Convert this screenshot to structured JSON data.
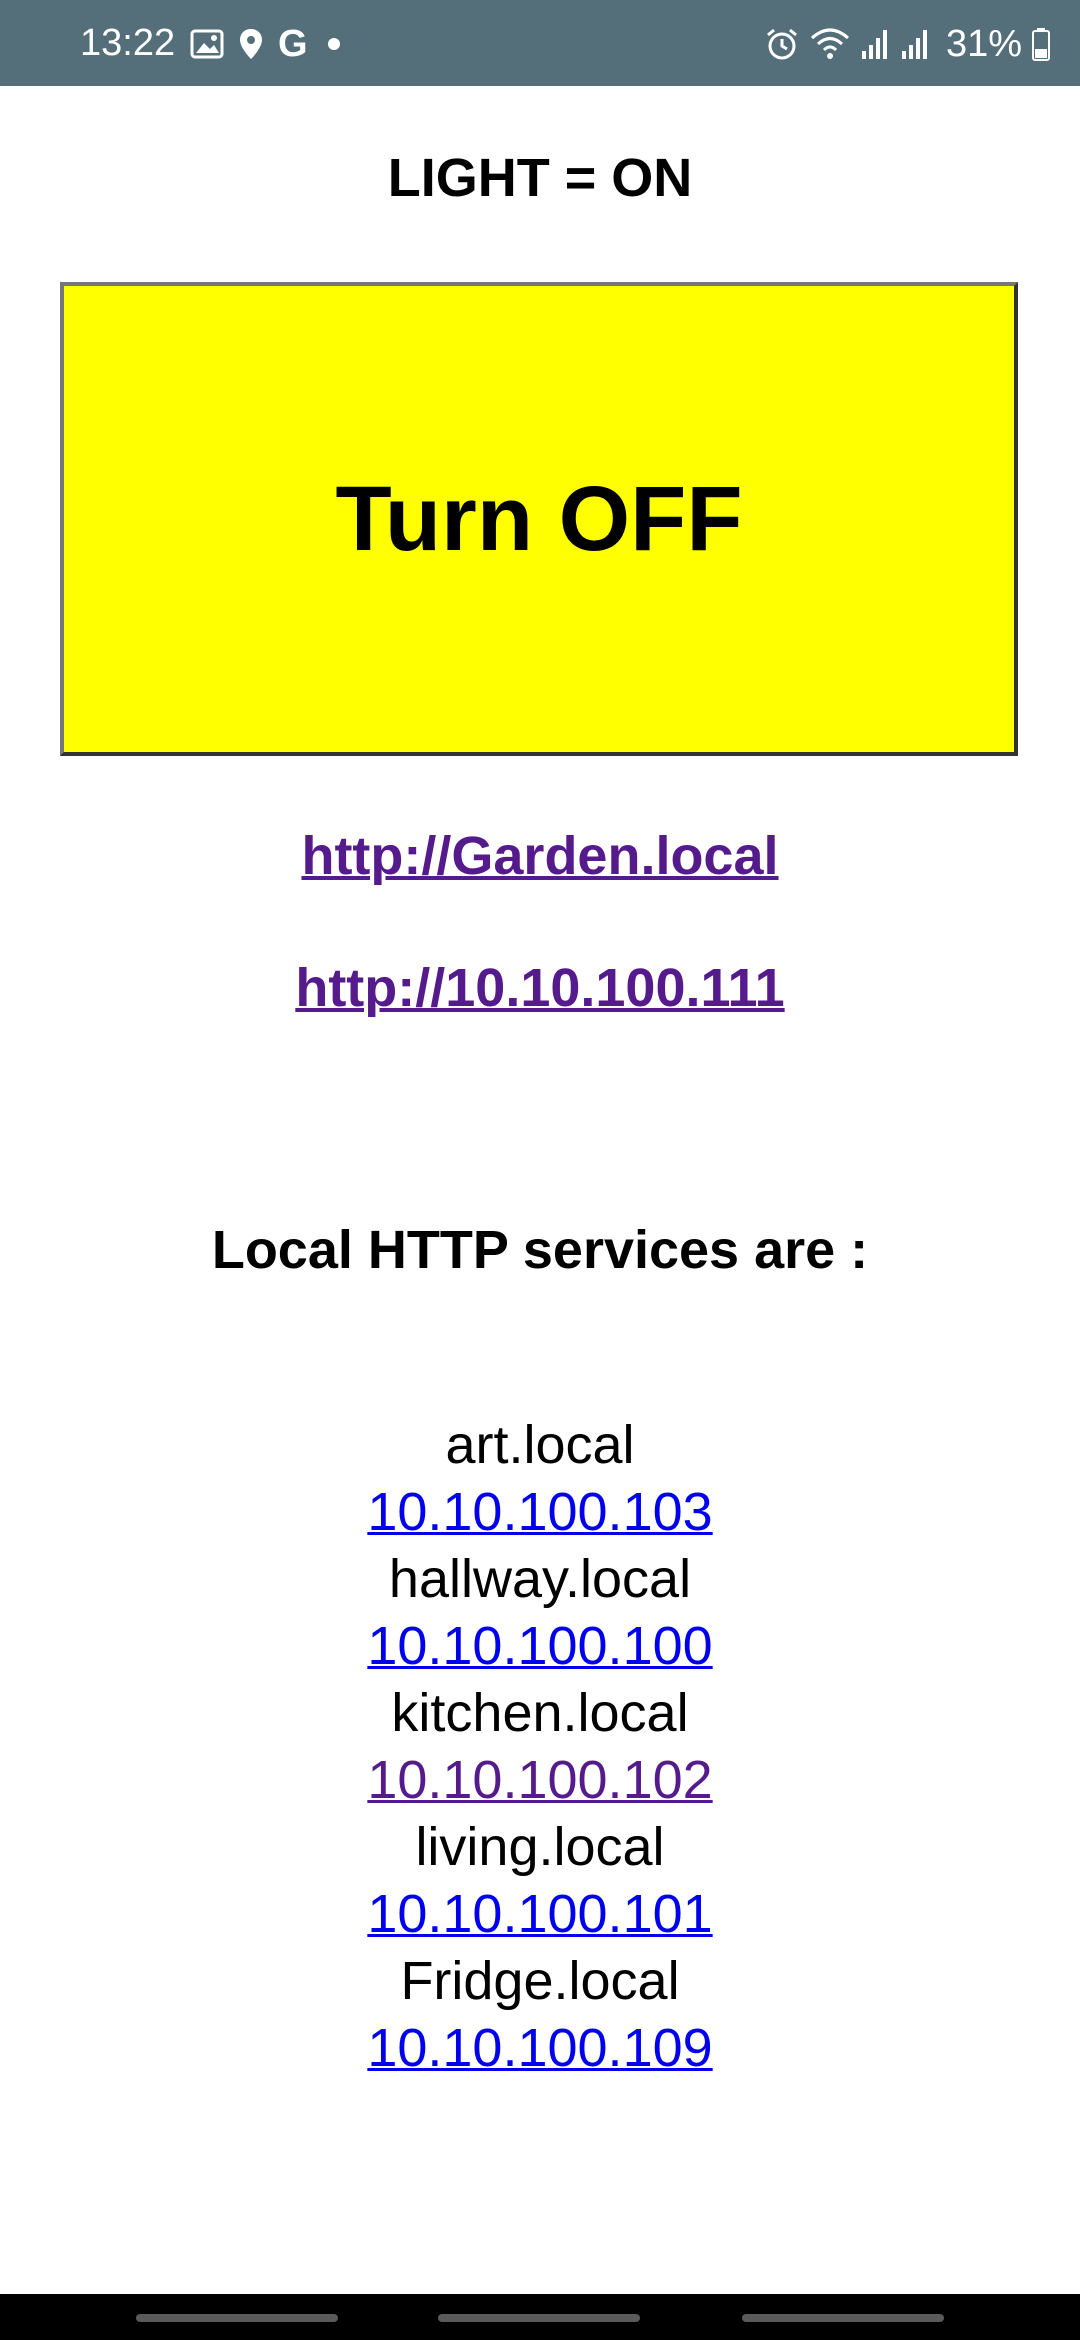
{
  "status_bar": {
    "time": "13:22",
    "battery": "31%",
    "left_icons": [
      "image-icon",
      "location-icon",
      "google-icon",
      "dot-icon"
    ],
    "right_icons": [
      "alarm-icon",
      "wifi-icon",
      "signal-icon",
      "signal-icon",
      "battery-icon"
    ],
    "google_glyph": "G"
  },
  "page": {
    "light_status": "LIGHT = ON",
    "toggle_button": "Turn OFF",
    "toggle_button_color": "#ffff00",
    "links": [
      "http://Garden.local",
      "http://10.10.100.111"
    ],
    "services_heading": "Local HTTP services are :",
    "services": [
      {
        "name": "art.local",
        "ip": "10.10.100.103",
        "visited": false
      },
      {
        "name": "hallway.local",
        "ip": "10.10.100.100",
        "visited": false
      },
      {
        "name": "kitchen.local",
        "ip": "10.10.100.102",
        "visited": true
      },
      {
        "name": "living.local",
        "ip": "10.10.100.101",
        "visited": false
      },
      {
        "name": "Fridge.local",
        "ip": "10.10.100.109",
        "visited": false
      }
    ]
  },
  "colors": {
    "status_bar_bg": "#546e7a",
    "link_visited": "#551a8b",
    "link_unvisited": "#0000ee"
  }
}
